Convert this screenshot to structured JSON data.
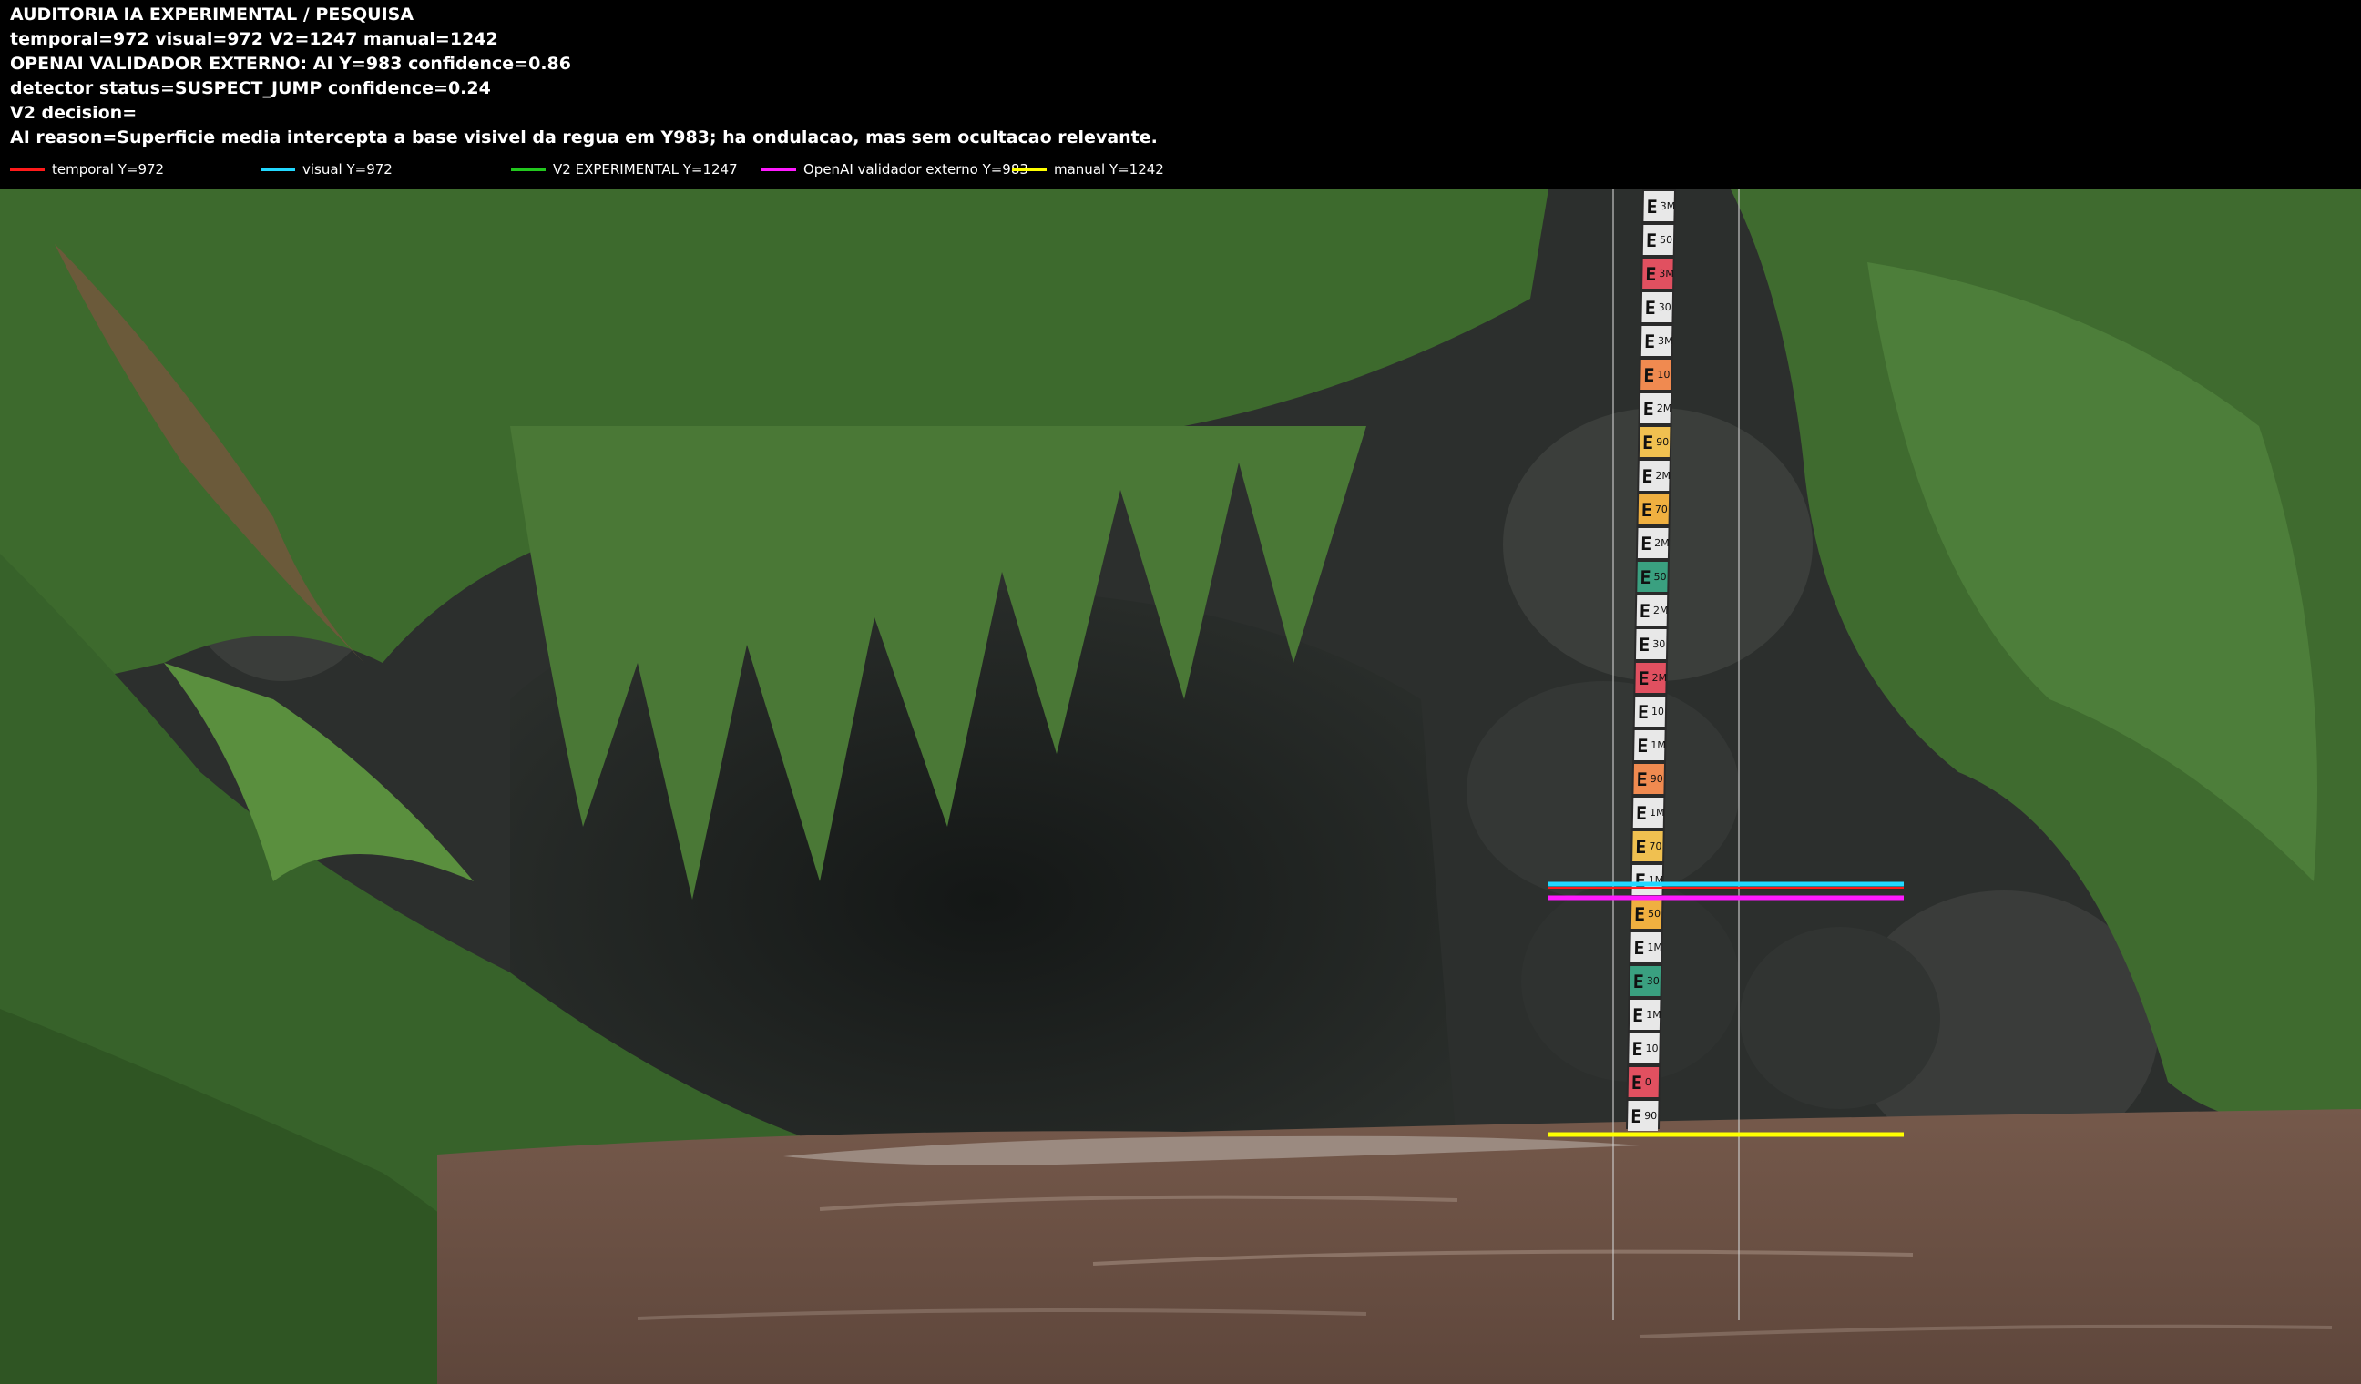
{
  "header": {
    "lines": [
      "AUDITORIA IA  EXPERIMENTAL / PESQUISA",
      "temporal=972  visual=972  V2=1247  manual=1242",
      "OPENAI  VALIDADOR EXTERNO: AI Y=983  confidence=0.86",
      "detector status=SUSPECT_JUMP confidence=0.24",
      "V2 decision=",
      "AI reason=Superficie media intercepta a base visivel da regua em Y983; ha ondulacao, mas sem ocultacao relevante."
    ]
  },
  "legend": [
    {
      "label": "temporal Y=972",
      "color": "#ff1a1a"
    },
    {
      "label": "visual Y=972",
      "color": "#22d8ff"
    },
    {
      "label": "V2 EXPERIMENTAL Y=1247",
      "color": "#22c81e"
    },
    {
      "label": "OpenAI validador externo Y=983",
      "color": "#ff1aff"
    },
    {
      "label": "manual Y=1242",
      "color": "#ffff00"
    }
  ],
  "scene": {
    "water_color": "#6b5145",
    "foliage_color": "#3e6a2e",
    "rock_color": "#2f302f",
    "staff_labels": [
      "3M",
      "50",
      "3M",
      "30",
      "3M",
      "10",
      "2M",
      "90",
      "2M",
      "70",
      "2M",
      "50",
      "2M",
      "30",
      "2M",
      "10",
      "1M",
      "90",
      "1M",
      "70",
      "1M",
      "50",
      "1M",
      "30",
      "1M",
      "10",
      "0",
      "90"
    ]
  }
}
